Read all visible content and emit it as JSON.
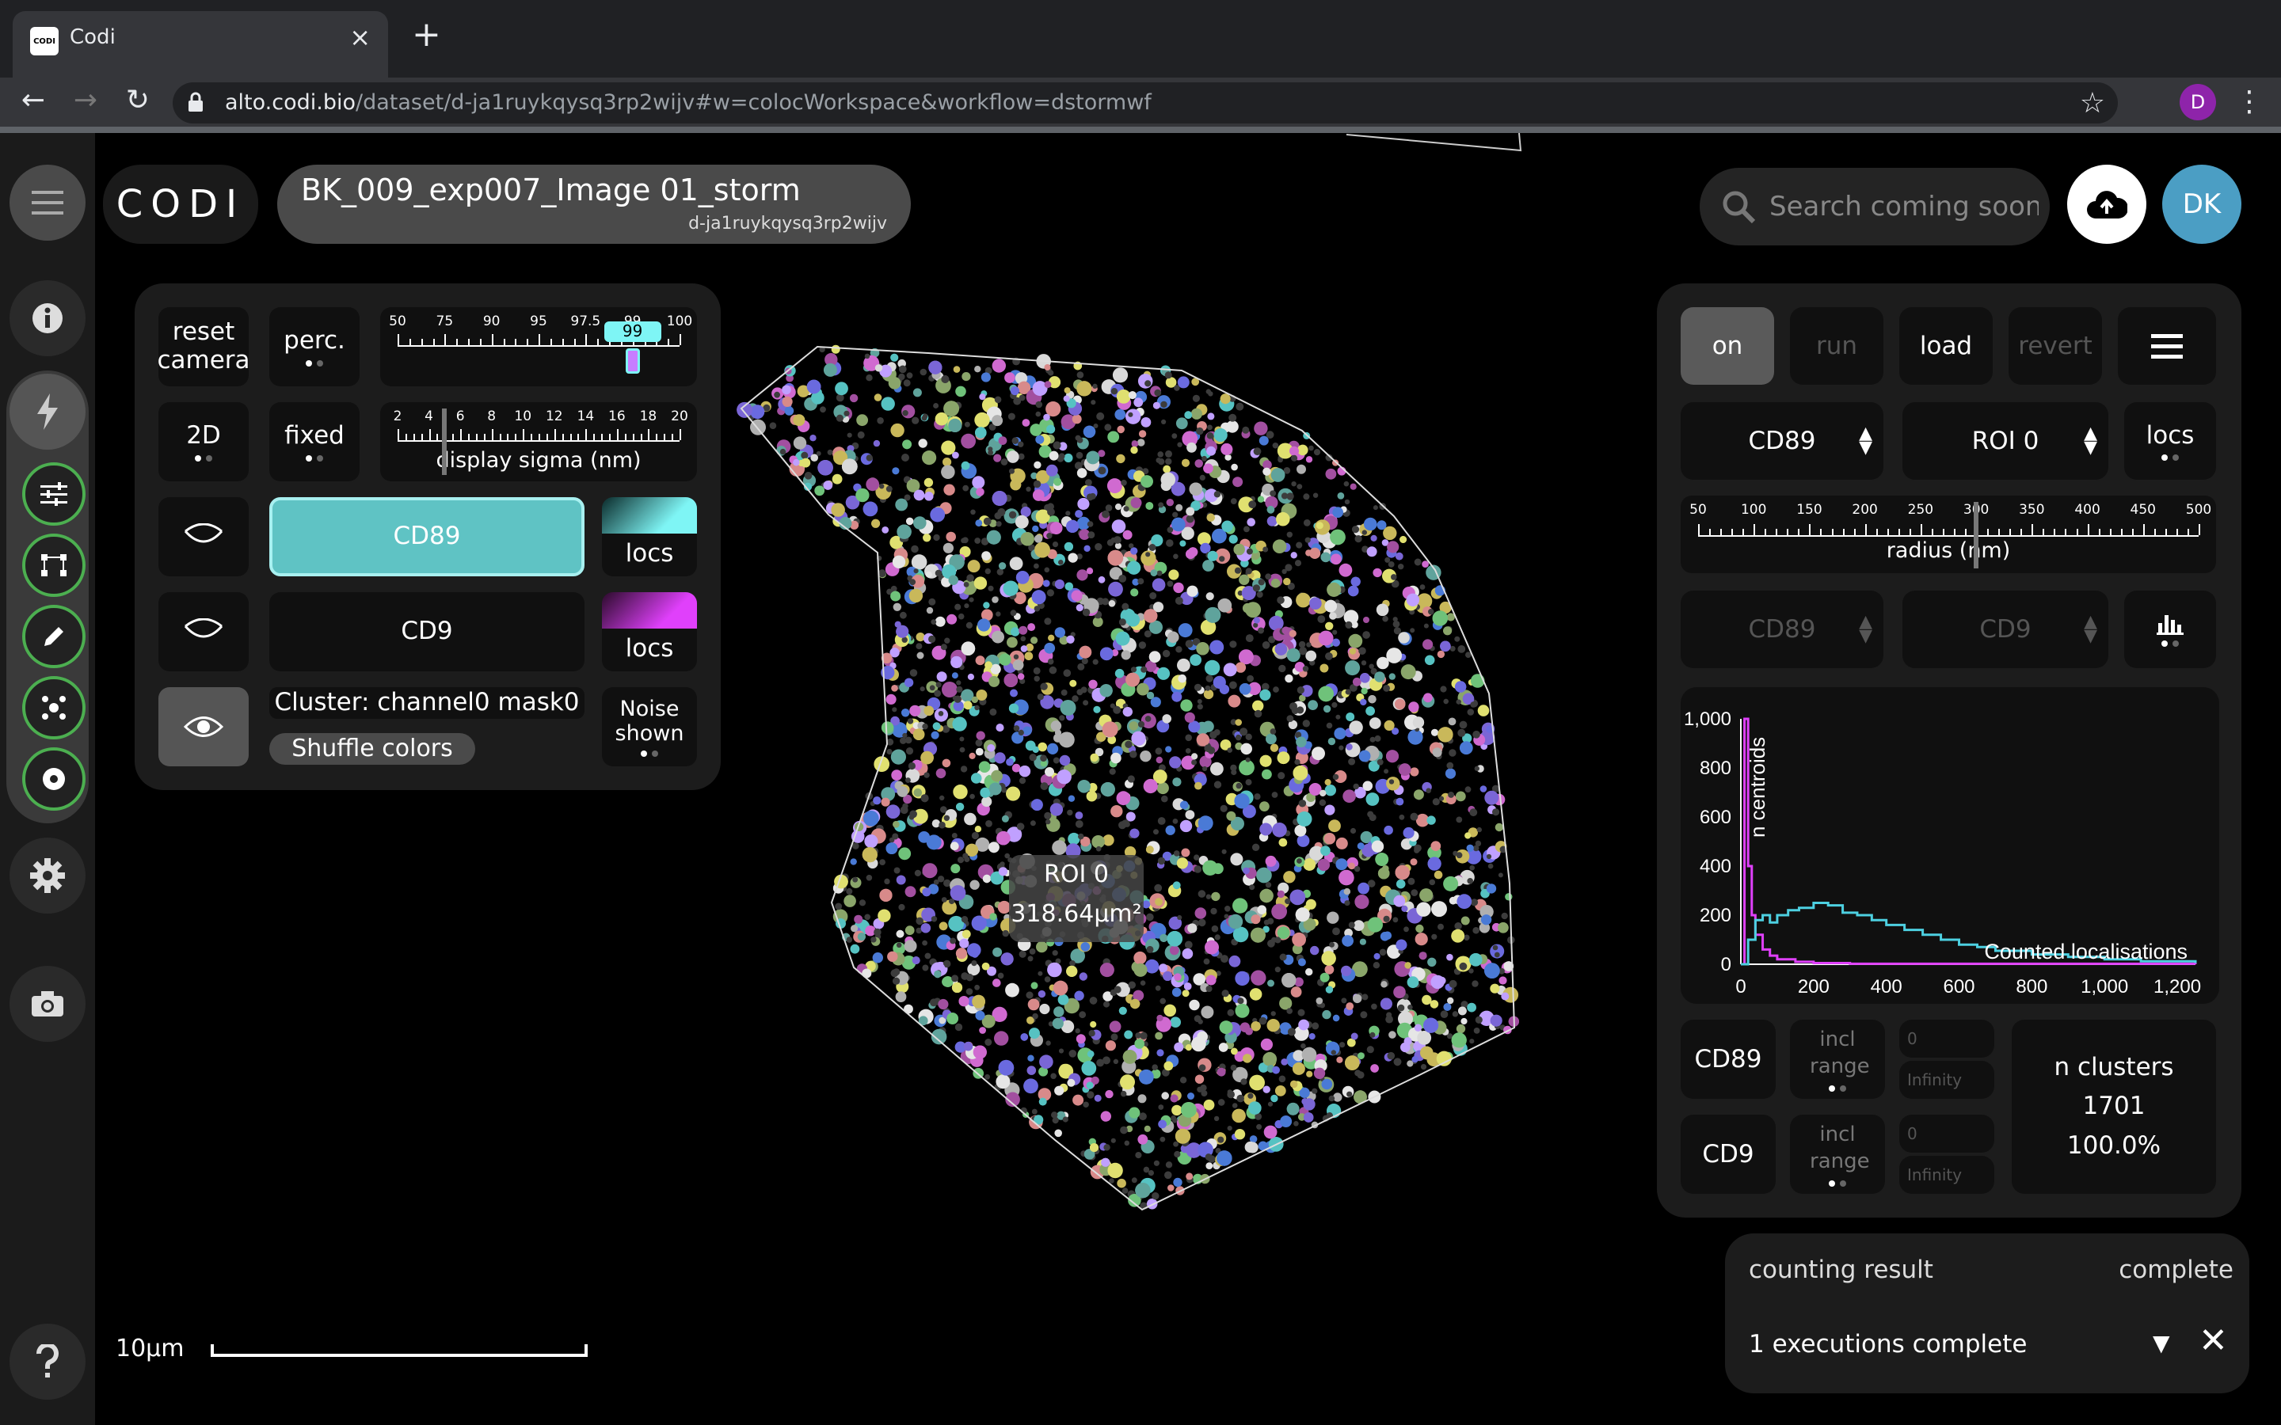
{
  "browser": {
    "tab_title": "Codi",
    "favicon_text": "CODI",
    "url_host": "alto.codi.bio",
    "url_path": "/dataset/d-ja1ruykqysq3rp2wijv#w=colocWorkspace&workflow=dstormwf",
    "profile_initial": "D"
  },
  "app": {
    "logo": "CODI",
    "dataset_title": "BK_009_exp007_Image 01_storm",
    "dataset_id": "d-ja1ruykqysq3rp2wijv",
    "search_placeholder": "Search coming soon!",
    "user_initials": "DK"
  },
  "left_panel": {
    "reset_camera": "reset camera",
    "perc": "perc.",
    "perc_slider": {
      "ticks": [
        "50",
        "75",
        "90",
        "95",
        "97.5",
        "99",
        "100"
      ],
      "value": "99"
    },
    "mode_2d": "2D",
    "fixed": "fixed",
    "sigma_slider": {
      "ticks": [
        "2",
        "4",
        "6",
        "8",
        "10",
        "12",
        "14",
        "16",
        "18",
        "20"
      ],
      "label": "display sigma (nm)",
      "value": 5
    },
    "channel1": "CD89",
    "channel2": "CD9",
    "locs": "locs",
    "cluster_label": "Cluster: channel0 mask0",
    "shuffle": "Shuffle colors",
    "noise": "Noise shown"
  },
  "canvas": {
    "roi_name": "ROI 0",
    "roi_area": "318.64µm²",
    "scale_label": "10µm"
  },
  "right_panel": {
    "on": "on",
    "run": "run",
    "load": "load",
    "revert": "revert",
    "channel_select": "CD89",
    "roi_select": "ROI 0",
    "locs": "locs",
    "radius_slider": {
      "ticks": [
        "50",
        "100",
        "150",
        "200",
        "250",
        "300",
        "350",
        "400",
        "450",
        "500"
      ],
      "label": "radius (nm)",
      "value": 300
    },
    "dim_select1": "CD89",
    "dim_select2": "CD9",
    "incl_range": "incl range",
    "range_min": "0",
    "range_max": "Infinity",
    "row1_channel": "CD89",
    "row2_channel": "CD9",
    "n_clusters_label": "n clusters",
    "n_clusters_value": "1701",
    "n_clusters_pct": "100.0%"
  },
  "chart_data": {
    "type": "line",
    "ylabel": "n centroids",
    "annotation": "Counted localisations",
    "xlim": [
      0,
      1250
    ],
    "ylim": [
      0,
      1000
    ],
    "x_ticks": [
      "0",
      "200",
      "400",
      "600",
      "800",
      "1,000",
      "1,200"
    ],
    "y_ticks": [
      "0",
      "200",
      "400",
      "600",
      "800",
      "1,000"
    ],
    "series": [
      {
        "color": "#e040fb",
        "x": [
          0,
          10,
          20,
          30,
          40,
          60,
          80,
          100,
          150,
          200,
          300,
          1250
        ],
        "y": [
          0,
          1000,
          400,
          200,
          120,
          60,
          35,
          20,
          10,
          5,
          2,
          0
        ]
      },
      {
        "color": "#4dd0e1",
        "x": [
          0,
          20,
          40,
          60,
          80,
          100,
          130,
          160,
          200,
          240,
          280,
          320,
          360,
          400,
          450,
          500,
          550,
          600,
          650,
          700,
          800,
          900,
          1000,
          1100,
          1250
        ],
        "y": [
          0,
          100,
          180,
          200,
          170,
          200,
          220,
          230,
          250,
          240,
          210,
          200,
          180,
          160,
          140,
          120,
          100,
          80,
          70,
          55,
          40,
          30,
          20,
          12,
          5
        ]
      }
    ]
  },
  "result": {
    "title": "counting result",
    "status": "complete",
    "message": "1 executions complete"
  }
}
